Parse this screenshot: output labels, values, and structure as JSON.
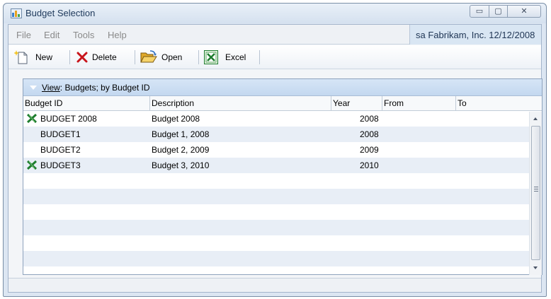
{
  "window": {
    "title": "Budget Selection",
    "controls": {
      "minimize": "▭",
      "maximize": "▢",
      "close": "✕"
    }
  },
  "menu": {
    "items": [
      "File",
      "Edit",
      "Tools",
      "Help"
    ],
    "status": "sa  Fabrikam, Inc.  12/12/2008"
  },
  "toolbar": {
    "new_label": "New",
    "delete_label": "Delete",
    "open_label": "Open",
    "excel_label": "Excel"
  },
  "view": {
    "prefix": "View",
    "rest": ": Budgets; by Budget ID"
  },
  "columns": [
    "Budget ID",
    "Description",
    "Year",
    "From",
    "To"
  ],
  "rows": [
    {
      "id": "BUDGET 2008",
      "description": "Budget 2008",
      "year": "2008",
      "from": "",
      "to": "",
      "excel": true
    },
    {
      "id": "BUDGET1",
      "description": "Budget 1, 2008",
      "year": "2008",
      "from": "",
      "to": "",
      "excel": false
    },
    {
      "id": "BUDGET2",
      "description": "Budget 2, 2009",
      "year": "2009",
      "from": "",
      "to": "",
      "excel": false
    },
    {
      "id": "BUDGET3",
      "description": "Budget 3, 2010",
      "year": "2010",
      "from": "",
      "to": "",
      "excel": true
    }
  ],
  "colors": {
    "accent": "#1e395b",
    "excel_green": "#1e7d2e",
    "delete_red": "#c8141b",
    "row_alt": "#e8eef6"
  },
  "icons": {
    "app": "budget-window-icon",
    "new": "new-document-icon",
    "delete": "delete-x-icon",
    "open": "open-folder-icon",
    "excel": "excel-icon",
    "row_excel": "excel-row-icon"
  }
}
